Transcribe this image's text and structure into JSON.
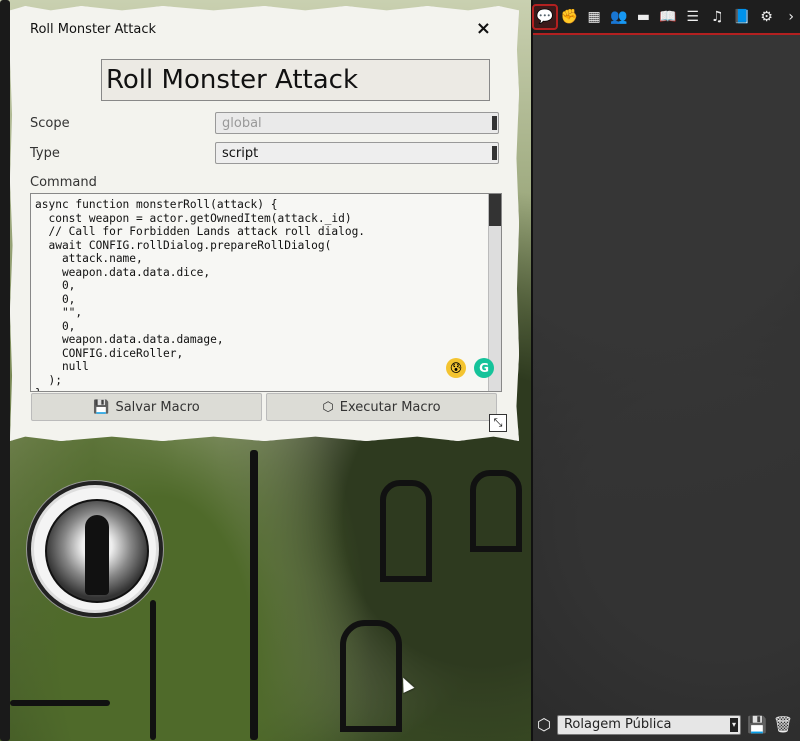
{
  "dialog": {
    "window_title": "Roll Monster Attack",
    "close_icon": "×",
    "name_value": "Roll Monster Attack",
    "scope_label": "Scope",
    "scope_value": "global",
    "type_label": "Type",
    "type_value": "script",
    "command_label": "Command",
    "command_text": "async function monsterRoll(attack) {\n  const weapon = actor.getOwnedItem(attack._id)\n  // Call for Forbidden Lands attack roll dialog.\n  await CONFIG.rollDialog.prepareRollDialog(\n    attack.name,\n    weapon.data.data.dice,\n    0,\n    0,\n    \"\",\n    0,\n    weapon.data.data.damage,\n    CONFIG.diceRoller,\n    null\n  );\n}",
    "save_label": "Salvar Macro",
    "execute_label": "Executar Macro"
  },
  "sidebar": {
    "tabs": [
      {
        "icon": "chat-icon",
        "glyph": "💬"
      },
      {
        "icon": "combat-icon",
        "glyph": "✊"
      },
      {
        "icon": "scenes-icon",
        "glyph": "▦"
      },
      {
        "icon": "actors-icon",
        "glyph": "👥"
      },
      {
        "icon": "items-icon",
        "glyph": "▬"
      },
      {
        "icon": "journal-icon",
        "glyph": "📖"
      },
      {
        "icon": "tables-icon",
        "glyph": "☰"
      },
      {
        "icon": "playlists-icon",
        "glyph": "♫"
      },
      {
        "icon": "compendium-icon",
        "glyph": "📘"
      },
      {
        "icon": "settings-icon",
        "glyph": "⚙"
      },
      {
        "icon": "collapse-icon",
        "glyph": "›"
      }
    ],
    "roll_mode": "Rolagem Pública"
  },
  "colors": {
    "accent": "#b32020",
    "dialog_bg": "#f3f3ee",
    "sidebar_bg": "#2a2a2a"
  }
}
